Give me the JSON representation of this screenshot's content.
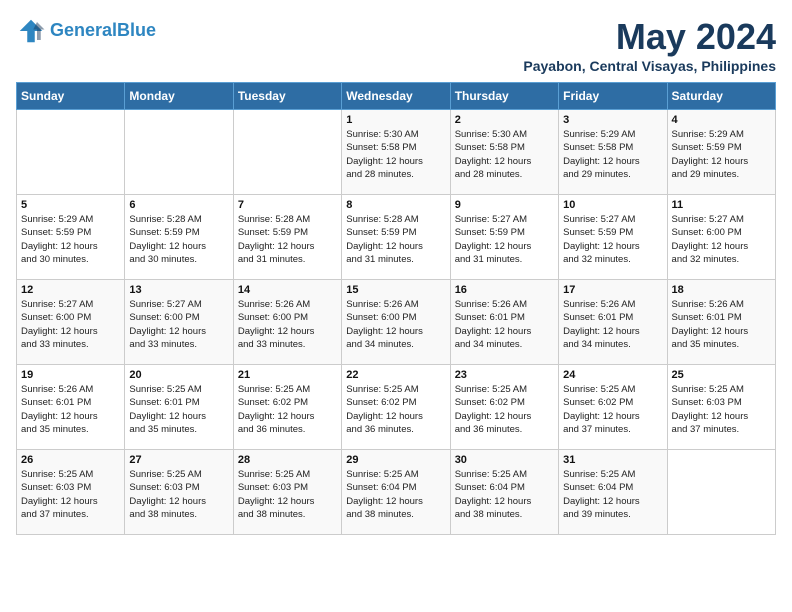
{
  "header": {
    "logo_line1": "General",
    "logo_line2": "Blue",
    "month_title": "May 2024",
    "location": "Payabon, Central Visayas, Philippines"
  },
  "days_of_week": [
    "Sunday",
    "Monday",
    "Tuesday",
    "Wednesday",
    "Thursday",
    "Friday",
    "Saturday"
  ],
  "weeks": [
    [
      {
        "num": "",
        "info": ""
      },
      {
        "num": "",
        "info": ""
      },
      {
        "num": "",
        "info": ""
      },
      {
        "num": "1",
        "info": "Sunrise: 5:30 AM\nSunset: 5:58 PM\nDaylight: 12 hours\nand 28 minutes."
      },
      {
        "num": "2",
        "info": "Sunrise: 5:30 AM\nSunset: 5:58 PM\nDaylight: 12 hours\nand 28 minutes."
      },
      {
        "num": "3",
        "info": "Sunrise: 5:29 AM\nSunset: 5:58 PM\nDaylight: 12 hours\nand 29 minutes."
      },
      {
        "num": "4",
        "info": "Sunrise: 5:29 AM\nSunset: 5:59 PM\nDaylight: 12 hours\nand 29 minutes."
      }
    ],
    [
      {
        "num": "5",
        "info": "Sunrise: 5:29 AM\nSunset: 5:59 PM\nDaylight: 12 hours\nand 30 minutes."
      },
      {
        "num": "6",
        "info": "Sunrise: 5:28 AM\nSunset: 5:59 PM\nDaylight: 12 hours\nand 30 minutes."
      },
      {
        "num": "7",
        "info": "Sunrise: 5:28 AM\nSunset: 5:59 PM\nDaylight: 12 hours\nand 31 minutes."
      },
      {
        "num": "8",
        "info": "Sunrise: 5:28 AM\nSunset: 5:59 PM\nDaylight: 12 hours\nand 31 minutes."
      },
      {
        "num": "9",
        "info": "Sunrise: 5:27 AM\nSunset: 5:59 PM\nDaylight: 12 hours\nand 31 minutes."
      },
      {
        "num": "10",
        "info": "Sunrise: 5:27 AM\nSunset: 5:59 PM\nDaylight: 12 hours\nand 32 minutes."
      },
      {
        "num": "11",
        "info": "Sunrise: 5:27 AM\nSunset: 6:00 PM\nDaylight: 12 hours\nand 32 minutes."
      }
    ],
    [
      {
        "num": "12",
        "info": "Sunrise: 5:27 AM\nSunset: 6:00 PM\nDaylight: 12 hours\nand 33 minutes."
      },
      {
        "num": "13",
        "info": "Sunrise: 5:27 AM\nSunset: 6:00 PM\nDaylight: 12 hours\nand 33 minutes."
      },
      {
        "num": "14",
        "info": "Sunrise: 5:26 AM\nSunset: 6:00 PM\nDaylight: 12 hours\nand 33 minutes."
      },
      {
        "num": "15",
        "info": "Sunrise: 5:26 AM\nSunset: 6:00 PM\nDaylight: 12 hours\nand 34 minutes."
      },
      {
        "num": "16",
        "info": "Sunrise: 5:26 AM\nSunset: 6:01 PM\nDaylight: 12 hours\nand 34 minutes."
      },
      {
        "num": "17",
        "info": "Sunrise: 5:26 AM\nSunset: 6:01 PM\nDaylight: 12 hours\nand 34 minutes."
      },
      {
        "num": "18",
        "info": "Sunrise: 5:26 AM\nSunset: 6:01 PM\nDaylight: 12 hours\nand 35 minutes."
      }
    ],
    [
      {
        "num": "19",
        "info": "Sunrise: 5:26 AM\nSunset: 6:01 PM\nDaylight: 12 hours\nand 35 minutes."
      },
      {
        "num": "20",
        "info": "Sunrise: 5:25 AM\nSunset: 6:01 PM\nDaylight: 12 hours\nand 35 minutes."
      },
      {
        "num": "21",
        "info": "Sunrise: 5:25 AM\nSunset: 6:02 PM\nDaylight: 12 hours\nand 36 minutes."
      },
      {
        "num": "22",
        "info": "Sunrise: 5:25 AM\nSunset: 6:02 PM\nDaylight: 12 hours\nand 36 minutes."
      },
      {
        "num": "23",
        "info": "Sunrise: 5:25 AM\nSunset: 6:02 PM\nDaylight: 12 hours\nand 36 minutes."
      },
      {
        "num": "24",
        "info": "Sunrise: 5:25 AM\nSunset: 6:02 PM\nDaylight: 12 hours\nand 37 minutes."
      },
      {
        "num": "25",
        "info": "Sunrise: 5:25 AM\nSunset: 6:03 PM\nDaylight: 12 hours\nand 37 minutes."
      }
    ],
    [
      {
        "num": "26",
        "info": "Sunrise: 5:25 AM\nSunset: 6:03 PM\nDaylight: 12 hours\nand 37 minutes."
      },
      {
        "num": "27",
        "info": "Sunrise: 5:25 AM\nSunset: 6:03 PM\nDaylight: 12 hours\nand 38 minutes."
      },
      {
        "num": "28",
        "info": "Sunrise: 5:25 AM\nSunset: 6:03 PM\nDaylight: 12 hours\nand 38 minutes."
      },
      {
        "num": "29",
        "info": "Sunrise: 5:25 AM\nSunset: 6:04 PM\nDaylight: 12 hours\nand 38 minutes."
      },
      {
        "num": "30",
        "info": "Sunrise: 5:25 AM\nSunset: 6:04 PM\nDaylight: 12 hours\nand 38 minutes."
      },
      {
        "num": "31",
        "info": "Sunrise: 5:25 AM\nSunset: 6:04 PM\nDaylight: 12 hours\nand 39 minutes."
      },
      {
        "num": "",
        "info": ""
      }
    ]
  ]
}
